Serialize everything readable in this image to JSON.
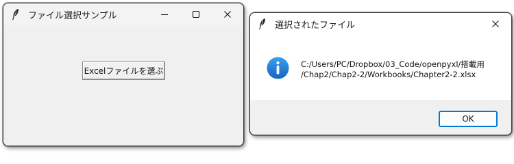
{
  "main_window": {
    "title": "ファイル選択サンプル",
    "icon": "feather-icon",
    "caption_buttons": [
      "minimize-icon",
      "maximize-icon",
      "close-icon"
    ],
    "button_label": "Excelファイルを選ぶ"
  },
  "dialog": {
    "title": "選択されたファイル",
    "icon": "feather-icon",
    "message_line1": "C:/Users/PC/Dropbox/03_Code/openpyxl/搭載用",
    "message_line2": "/Chap2/Chap2-2/Workbooks/Chapter2-2.xlsx",
    "info_icon": "info-icon",
    "ok_label": "OK",
    "info_color": "#1e88e5"
  }
}
